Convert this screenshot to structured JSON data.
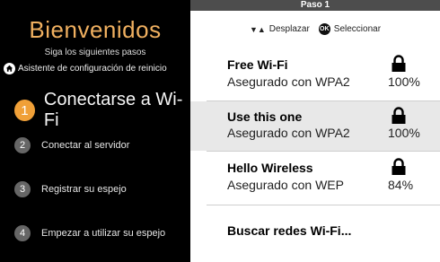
{
  "welcome": {
    "title": "Bienvenidos",
    "subtitle": "Siga los siguientes pasos",
    "restart_label": "Asistente de configuración de reinicio"
  },
  "steps": [
    {
      "number": "1",
      "label": "Conectarse a Wi-Fi",
      "active": true
    },
    {
      "number": "2",
      "label": "Conectar al servidor",
      "active": false
    },
    {
      "number": "3",
      "label": "Registrar su espejo",
      "active": false
    },
    {
      "number": "4",
      "label": "Empezar a utilizar su espejo",
      "active": false
    }
  ],
  "header": {
    "step_title": "Paso 1",
    "scroll_arrows": "▼▲",
    "scroll_label": "Desplazar",
    "ok_button": "OK",
    "select_label": "Seleccionar"
  },
  "networks": [
    {
      "name": "Free Wi-Fi",
      "security": "Asegurado con WPA2",
      "signal": "100%",
      "selected": false
    },
    {
      "name": "Use this one",
      "security": "Asegurado con WPA2",
      "signal": "100%",
      "selected": true
    },
    {
      "name": "Hello Wireless",
      "security": "Asegurado con WEP",
      "signal": "84%",
      "selected": false
    }
  ],
  "search_label": "Buscar redes Wi-Fi...",
  "colors": {
    "accent": "#f0a038",
    "title": "#f0b060",
    "sidebar_bg": "#000000",
    "step_badge": "#666666",
    "topbar": "#4d4d4d",
    "selected_row": "#e8e8e8"
  },
  "icons": {
    "restart": "home-icon",
    "network_lock": "lock-icon"
  }
}
